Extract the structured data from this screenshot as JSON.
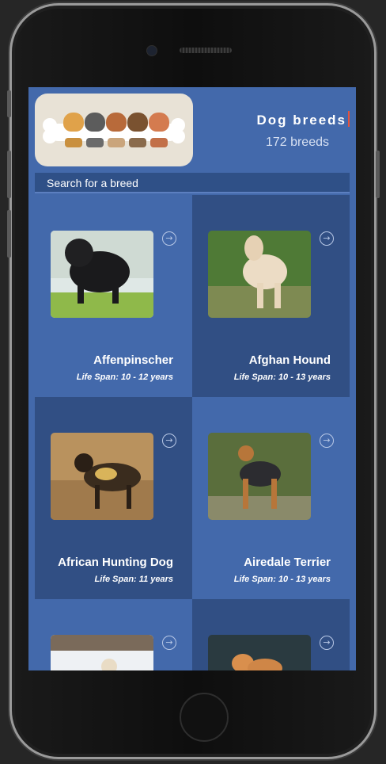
{
  "header": {
    "title": "Dog breeds",
    "breed_count": "172 breeds"
  },
  "search": {
    "placeholder": "Search for a breed"
  },
  "breeds": [
    {
      "name": "Affenpinscher",
      "life_span": "Life Span: 10 - 12 years",
      "photo": "black-shaggy-dog-on-grass"
    },
    {
      "name": "Afghan Hound",
      "life_span": "Life Span: 10 - 13 years",
      "photo": "cream-long-haired-hound"
    },
    {
      "name": "African Hunting Dog",
      "life_span": "Life Span: 11 years",
      "photo": "wild-dog-in-dry-grass"
    },
    {
      "name": "Airedale Terrier",
      "life_span": "Life Span: 10 - 13 years",
      "photo": "tan-and-black-terrier"
    },
    {
      "name": "",
      "life_span": "",
      "photo": "white-dog-in-snow"
    },
    {
      "name": "",
      "life_span": "",
      "photo": "red-akita-dog"
    }
  ],
  "icons": {
    "card_arrow": "arrow-right-circle-icon"
  },
  "colors": {
    "background": "#4369ab",
    "card_dark": "#314f84",
    "accent_cursor": "#e5533d"
  }
}
